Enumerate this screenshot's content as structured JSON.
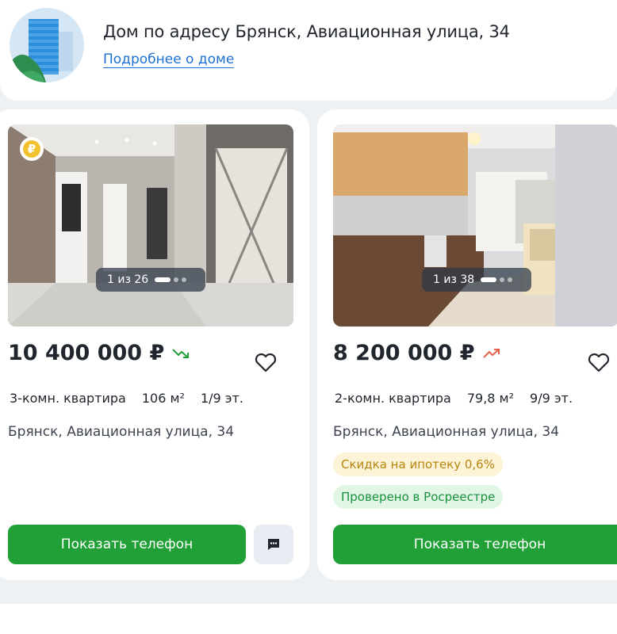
{
  "house": {
    "title": "Дом по адресу Брянск, Авиационная улица, 34",
    "details_link": "Подробнее о доме",
    "logo_icon": "building-icon"
  },
  "listings": [
    {
      "photo_counter": "1 из 26",
      "badge_icon": "ruble-icon",
      "badge_symbol": "₽",
      "price": "10 400 000 ₽",
      "price_trend": "down",
      "rooms": "3-комн. квартира",
      "area": "106 м²",
      "floor": "1/9 эт.",
      "address": "Брянск, Авиационная улица, 34",
      "phone_button": "Показать телефон",
      "chat_icon": "chat-icon"
    },
    {
      "photo_counter": "1 из 38",
      "price": "8 200 000 ₽",
      "price_trend": "up",
      "rooms": "2-комн. квартира",
      "area": "79,8 м²",
      "floor": "9/9 эт.",
      "address": "Брянск, Авиационная улица, 34",
      "tags": [
        "Скидка на ипотеку 0,6%",
        "Проверено в Росреестре"
      ],
      "phone_button": "Показать телефон"
    }
  ],
  "colors": {
    "accent_green": "#21a038",
    "link_blue": "#1d6fd1",
    "trend_down": "#21a038",
    "trend_up": "#e8604c"
  }
}
